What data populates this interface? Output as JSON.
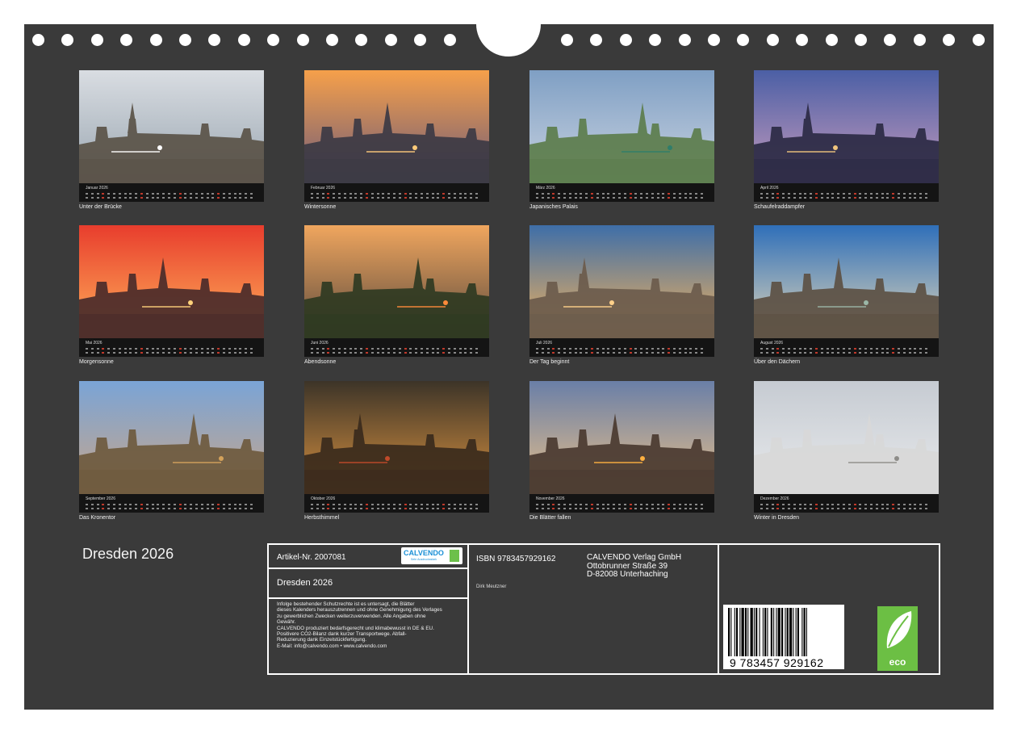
{
  "calendar_title": "Dresden 2026",
  "months": [
    {
      "name": "Januar 2026",
      "caption": "Unter der Brücke",
      "sky": [
        "#d9dde2",
        "#9aa6b1"
      ],
      "ground": "#5a5248",
      "accent": "#ffffff"
    },
    {
      "name": "Februar 2026",
      "caption": "Wintersonne",
      "sky": [
        "#f6a04a",
        "#6c5a7a"
      ],
      "ground": "#3c3a44",
      "accent": "#ffcb7a"
    },
    {
      "name": "März 2026",
      "caption": "Japanisches Palais",
      "sky": [
        "#7f9fc4",
        "#c9d3e0"
      ],
      "ground": "#5c7d4c",
      "accent": "#2f7d6a"
    },
    {
      "name": "April 2026",
      "caption": "Schaufelraddampfer",
      "sky": [
        "#4b5fa5",
        "#c69bbd"
      ],
      "ground": "#2b2a44",
      "accent": "#f1c57d"
    },
    {
      "name": "Mai 2026",
      "caption": "Morgensonne",
      "sky": [
        "#e83d2d",
        "#ffb15a"
      ],
      "ground": "#4a2b2a",
      "accent": "#ffd27a"
    },
    {
      "name": "Juni 2026",
      "caption": "Abendsonne",
      "sky": [
        "#f0a65e",
        "#5b4a3e"
      ],
      "ground": "#2f3a22",
      "accent": "#ff8a3a"
    },
    {
      "name": "Juli 2026",
      "caption": "Der Tag beginnt",
      "sky": [
        "#3e6ea8",
        "#f4b35c"
      ],
      "ground": "#6b5b4c",
      "accent": "#ffd08a"
    },
    {
      "name": "August 2026",
      "caption": "Über den Dächern",
      "sky": [
        "#2f6fb9",
        "#e2d7b9"
      ],
      "ground": "#5c5043",
      "accent": "#9bb7a7"
    },
    {
      "name": "September 2026",
      "caption": "Das Kronentor",
      "sky": [
        "#7aa4d6",
        "#c8a68a"
      ],
      "ground": "#6e5a3e",
      "accent": "#d4a25b"
    },
    {
      "name": "Oktober 2026",
      "caption": "Herbsthimmel",
      "sky": [
        "#3c3428",
        "#d89140"
      ],
      "ground": "#3a2a1c",
      "accent": "#c04a2a"
    },
    {
      "name": "November 2026",
      "caption": "Die Blätter fallen",
      "sky": [
        "#6a7fa7",
        "#e8c08a"
      ],
      "ground": "#4a3a30",
      "accent": "#ffb040"
    },
    {
      "name": "Dezember 2026",
      "caption": "Winter in Dresden",
      "sky": [
        "#c6cbd2",
        "#e8eaec"
      ],
      "ground": "#d8d8d8",
      "accent": "#8d8c88"
    }
  ],
  "info": {
    "article_no": "Artikel-Nr. 2007081",
    "logo_text": "CALVENDO",
    "logo_sub": "Sehr Ausdrucksstark",
    "title": "Dresden 2026",
    "legal": [
      "Infolge bestehender Schutzrechte ist es untersagt, die Blätter",
      "dieses Kalenders herauszutrennen und ohne Genehmigung des Verlages",
      "zu gewerblichen Zwecken weiterzuverwenden. Alle Angaben ohne",
      "Gewähr.",
      "CALVENDO produziert bedarfsgerecht und klimabewusst in DE & EU.",
      "Positivere CO2-Bilanz dank kurzer Transportwege. Abfall-",
      "Reduzierung dank Einzelstückfertigung.",
      "E-Mail: info@calvendo.com • www.calvendo.com"
    ],
    "isbn": "ISBN 9783457929162",
    "publisher": [
      "CALVENDO Verlag GmbH",
      "Ottobrunner Straße 39",
      "D-82008 Unterhaching"
    ],
    "author": "Dirk Meutzner",
    "barcode_number": "9 783457 929162",
    "eco_label": "eco"
  }
}
